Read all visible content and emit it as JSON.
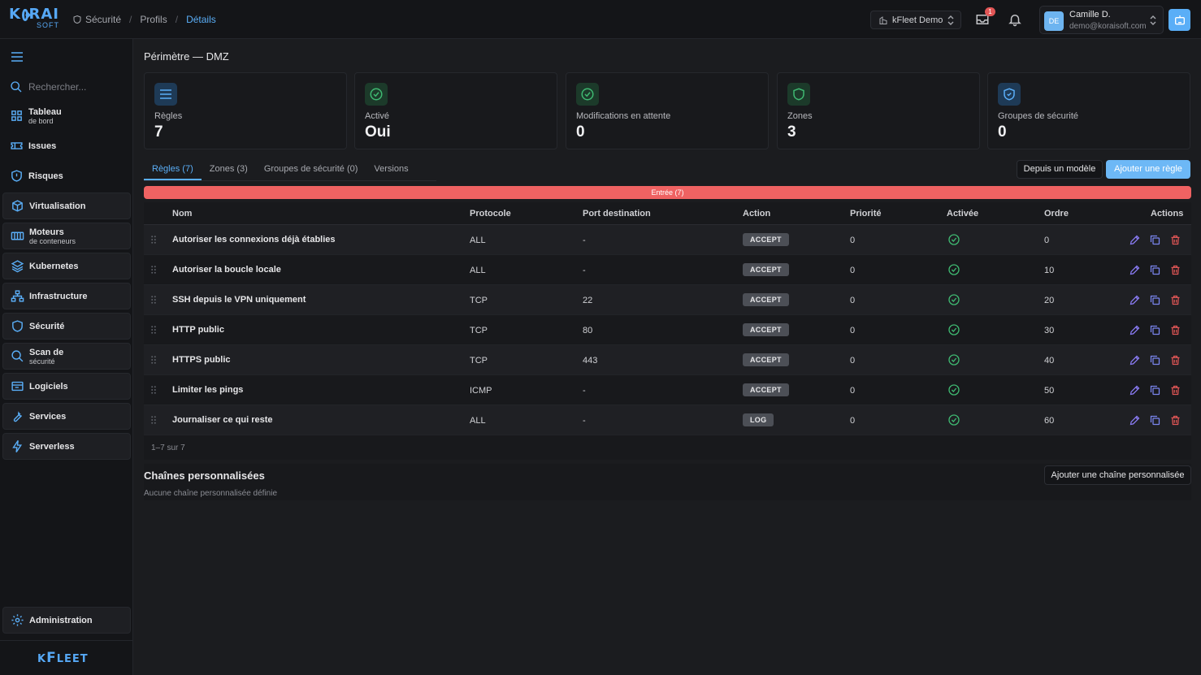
{
  "header": {
    "logo_top_left": "K",
    "logo_top_right": "RAI",
    "logo_bottom": "SOFT",
    "breadcrumb": [
      "Sécurité",
      "Profils",
      "Détails"
    ],
    "breadcrumb_sep": "/",
    "tenant": "kFleet Demo",
    "notification_count": "1",
    "user": {
      "initials": "DE",
      "name": "Camille D.",
      "email": "demo@koraisoft.com"
    }
  },
  "sidebar": {
    "search_placeholder": "Rechercher...",
    "items": [
      {
        "label": "Tableau",
        "sub": "de bord",
        "icon": "grid-icon"
      },
      {
        "label": "Issues",
        "sub": "",
        "icon": "ticket-icon"
      },
      {
        "label": "Risques",
        "sub": "",
        "icon": "shield-alert-icon"
      },
      {
        "label": "Virtualisation",
        "sub": "",
        "icon": "cube-icon"
      },
      {
        "label": "Moteurs",
        "sub": "de conteneurs",
        "icon": "container-icon"
      },
      {
        "label": "Kubernetes",
        "sub": "",
        "icon": "layers-icon"
      },
      {
        "label": "Infrastructure",
        "sub": "",
        "icon": "network-icon"
      },
      {
        "label": "Sécurité",
        "sub": "",
        "icon": "shield-icon"
      },
      {
        "label": "Scan de",
        "sub": "sécurité",
        "icon": "scan-icon"
      },
      {
        "label": "Logiciels",
        "sub": "",
        "icon": "package-icon"
      },
      {
        "label": "Services",
        "sub": "",
        "icon": "wrench-icon"
      },
      {
        "label": "Serverless",
        "sub": "",
        "icon": "bolt-icon"
      }
    ],
    "admin_label": "Administration",
    "brand_first": "K",
    "brand_f": "F",
    "brand_rest": "LEET"
  },
  "page": {
    "title": "Périmètre — DMZ",
    "stats": [
      {
        "label": "Règles",
        "value": "7",
        "icon": "list-icon"
      },
      {
        "label": "Activé",
        "value": "Oui",
        "icon": "check-circle-icon"
      },
      {
        "label": "Modifications en attente",
        "value": "0",
        "icon": "check-circle-icon"
      },
      {
        "label": "Zones",
        "value": "3",
        "icon": "shield-icon"
      },
      {
        "label": "Groupes de sécurité",
        "value": "0",
        "icon": "shield-check-icon"
      }
    ],
    "tabs": [
      "Règles (7)",
      "Zones (3)",
      "Groupes de sécurité (0)",
      "Versions"
    ],
    "btn_template": "Depuis un modèle",
    "btn_add_rule": "Ajouter une règle",
    "entry_label": "Entrée (7)",
    "columns": [
      "Nom",
      "Protocole",
      "Port destination",
      "Action",
      "Priorité",
      "Activée",
      "Ordre",
      "Actions"
    ],
    "rules": [
      {
        "name": "Autoriser les connexions déjà établies",
        "protocol": "ALL",
        "port": "-",
        "action": "ACCEPT",
        "priority": "0",
        "order": "0"
      },
      {
        "name": "Autoriser la boucle locale",
        "protocol": "ALL",
        "port": "-",
        "action": "ACCEPT",
        "priority": "0",
        "order": "10"
      },
      {
        "name": "SSH depuis le VPN uniquement",
        "protocol": "TCP",
        "port": "22",
        "action": "ACCEPT",
        "priority": "0",
        "order": "20"
      },
      {
        "name": "HTTP public",
        "protocol": "TCP",
        "port": "80",
        "action": "ACCEPT",
        "priority": "0",
        "order": "30"
      },
      {
        "name": "HTTPS public",
        "protocol": "TCP",
        "port": "443",
        "action": "ACCEPT",
        "priority": "0",
        "order": "40"
      },
      {
        "name": "Limiter les pings",
        "protocol": "ICMP",
        "port": "-",
        "action": "ACCEPT",
        "priority": "0",
        "order": "50"
      },
      {
        "name": "Journaliser ce qui reste",
        "protocol": "ALL",
        "port": "-",
        "action": "LOG",
        "priority": "0",
        "order": "60"
      }
    ],
    "pagination": "1–7 sur 7",
    "chains_title": "Chaînes personnalisées",
    "chains_empty": "Aucune chaîne personnalisée définie",
    "btn_add_chain": "Ajouter une chaîne personnalisée"
  },
  "colors": {
    "accent": "#5aaef7",
    "danger": "#ef6262",
    "success": "#3fb871",
    "edit": "#8b7cf6",
    "copy": "#7b86f0",
    "delete": "#e25656"
  }
}
